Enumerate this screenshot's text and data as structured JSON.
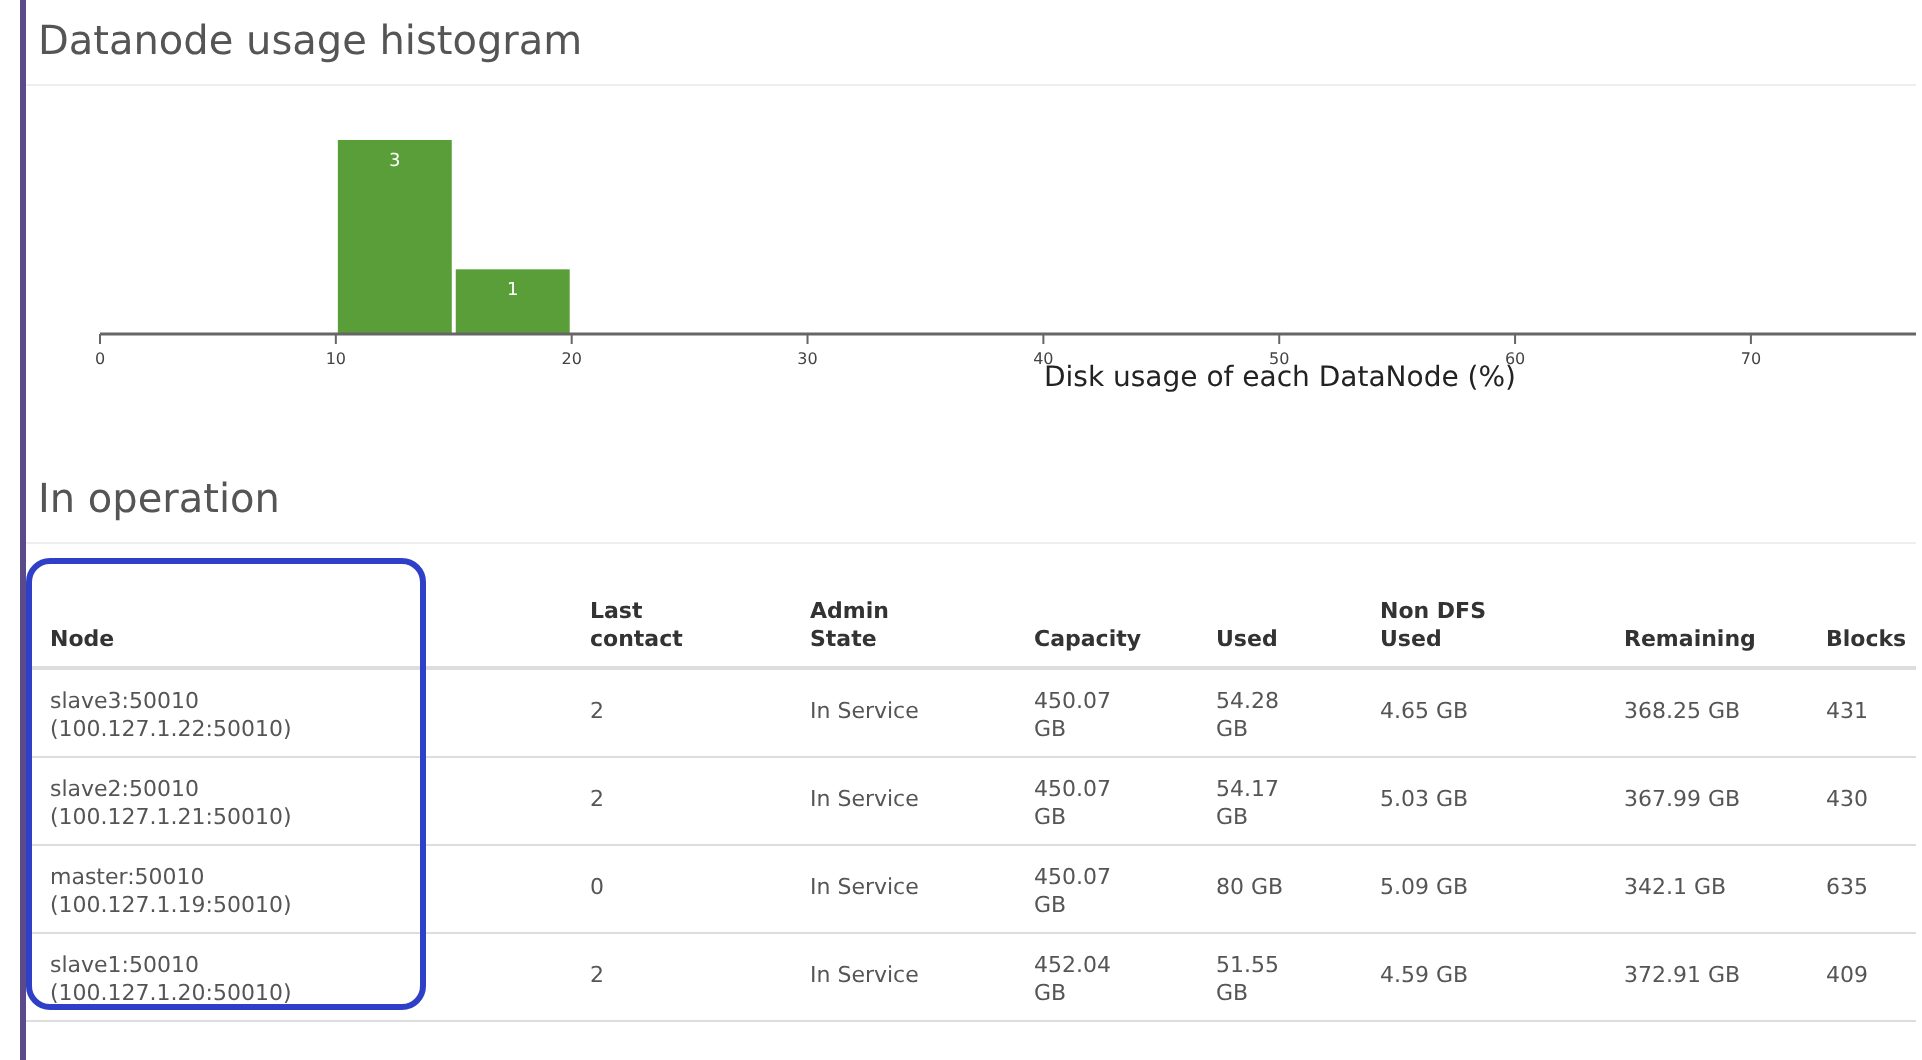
{
  "histogram": {
    "title": "Datanode usage histogram",
    "chart_data": {
      "type": "bar",
      "xlabel": "Disk usage of each DataNode (%)",
      "x": [
        12.5,
        17.5
      ],
      "values": [
        3,
        1
      ],
      "xlim": [
        0,
        77
      ],
      "ylim": [
        0,
        3
      ],
      "xticks": [
        0,
        10,
        20,
        30,
        40,
        50,
        60,
        70
      ],
      "data_labels": true
    }
  },
  "operation": {
    "title": "In operation",
    "table": {
      "columns": [
        "Node",
        "Last contact",
        "Admin State",
        "Capacity",
        "Used",
        "Non DFS Used",
        "Remaining",
        "Blocks"
      ],
      "rows": [
        [
          "slave3:50010 (100.127.1.22:50010)",
          "2",
          "In Service",
          "450.07 GB",
          "54.28 GB",
          "4.65 GB",
          "368.25 GB",
          "431"
        ],
        [
          "slave2:50010 (100.127.1.21:50010)",
          "2",
          "In Service",
          "450.07 GB",
          "54.17 GB",
          "5.03 GB",
          "367.99 GB",
          "430"
        ],
        [
          "master:50010 (100.127.1.19:50010)",
          "0",
          "In Service",
          "450.07 GB",
          "80 GB",
          "5.09 GB",
          "342.1 GB",
          "635"
        ],
        [
          "slave1:50010 (100.127.1.20:50010)",
          "2",
          "In Service",
          "452.04 GB",
          "51.55 GB",
          "4.59 GB",
          "372.91 GB",
          "409"
        ]
      ]
    }
  }
}
